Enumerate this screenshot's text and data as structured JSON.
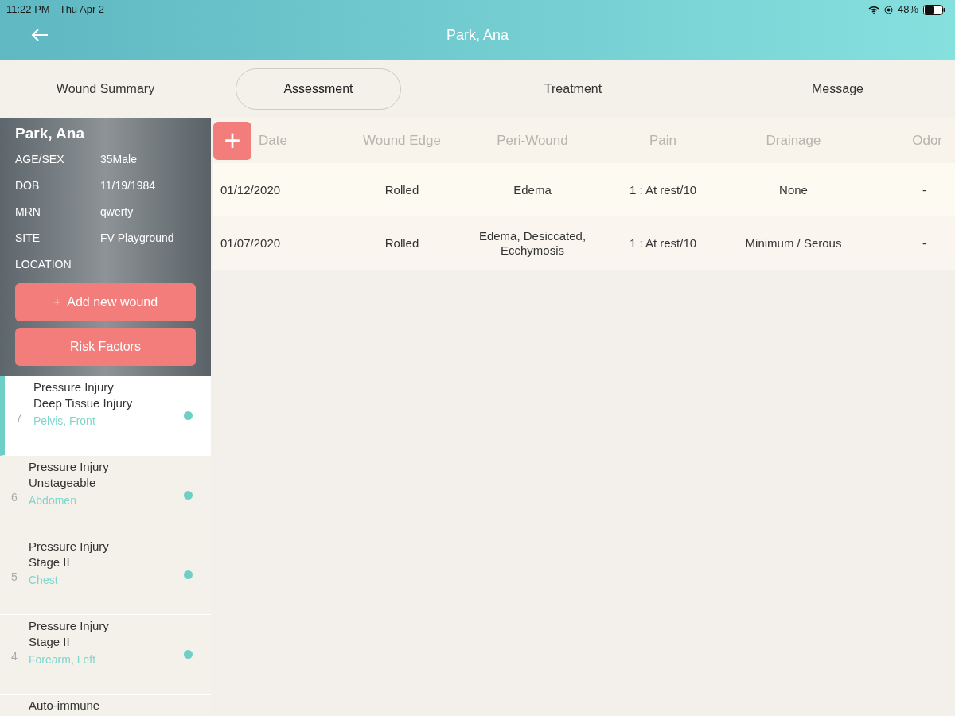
{
  "status_bar": {
    "time": "11:22 PM",
    "date": "Thu Apr 2",
    "battery": "48%"
  },
  "header": {
    "title": "Park, Ana"
  },
  "tabs": [
    {
      "label": "Wound Summary",
      "selected": false
    },
    {
      "label": "Assessment",
      "selected": true
    },
    {
      "label": "Treatment",
      "selected": false
    },
    {
      "label": "Message",
      "selected": false
    }
  ],
  "patient": {
    "name": "Park, Ana",
    "fields": [
      {
        "label": "AGE/SEX",
        "value": "35Male"
      },
      {
        "label": "DOB",
        "value": "11/19/1984"
      },
      {
        "label": "MRN",
        "value": "qwerty"
      },
      {
        "label": "SITE",
        "value": "FV Playground"
      },
      {
        "label": "LOCATION"
      }
    ],
    "add_button": "+  Add new wound",
    "risk_button": "Risk Factors"
  },
  "wounds": [
    {
      "number": "7",
      "title": "Pressure Injury",
      "subtitle": "Deep Tissue Injury",
      "location": "Pelvis, Front",
      "color": "#6fcfc6",
      "selected": true
    },
    {
      "number": "6",
      "title": "Pressure Injury",
      "subtitle": "Unstageable",
      "location": "Abdomen",
      "color": "#6fcfc6",
      "selected": false
    },
    {
      "number": "5",
      "title": "Pressure Injury",
      "subtitle": "Stage II",
      "location": "Chest",
      "color": "#6fcfc6",
      "selected": false
    },
    {
      "number": "4",
      "title": "Pressure Injury",
      "subtitle": "Stage II",
      "location": "Forearm, Left",
      "color": "#6fcfc6",
      "selected": false
    },
    {
      "title": "Auto-immune"
    }
  ],
  "table": {
    "add_icon": "+",
    "columns": [
      "Date",
      "Wound Edge",
      "Peri-Wound",
      "Pain",
      "Drainage",
      "Odor"
    ],
    "rows": [
      [
        "01/12/2020",
        "Rolled",
        "Edema",
        "1 : At rest/10",
        "None",
        "-"
      ],
      [
        "01/07/2020",
        "Rolled",
        "Edema, Desiccated, Ecchymosis",
        "1 : At rest/10",
        "Minimum / Serous",
        "-"
      ]
    ]
  }
}
